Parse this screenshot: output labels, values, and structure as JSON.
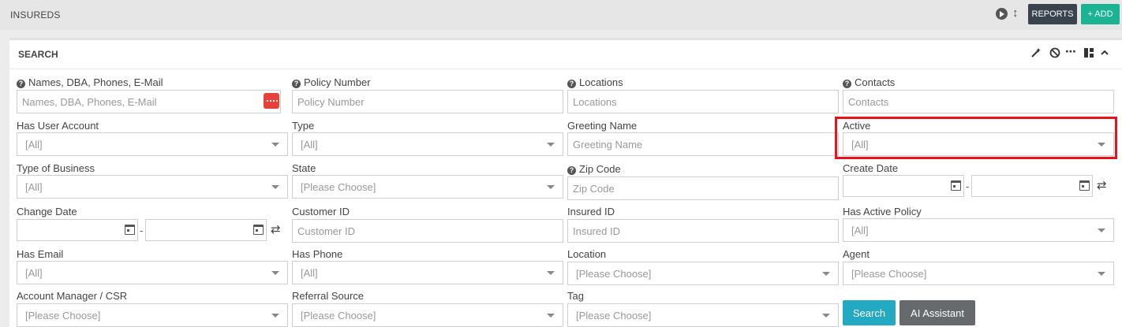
{
  "header": {
    "title": "INSUREDS",
    "icons": [
      "play-icon",
      "up-down-arrow-icon"
    ],
    "reports_label": "REPORTS",
    "add_label": "+ ADD"
  },
  "panel": {
    "title": "SEARCH",
    "toolbar_icons": [
      "magic-wand-icon",
      "ban-icon",
      "more-icon",
      "layout-icon",
      "chevron-up-icon"
    ]
  },
  "fields": {
    "names": {
      "label": "Names, DBA, Phones, E-Mail",
      "placeholder": "Names, DBA, Phones, E-Mail"
    },
    "policy_number": {
      "label": "Policy Number",
      "placeholder": "Policy Number"
    },
    "locations": {
      "label": "Locations",
      "placeholder": "Locations"
    },
    "contacts": {
      "label": "Contacts",
      "placeholder": "Contacts"
    },
    "has_user_account": {
      "label": "Has User Account",
      "value": "[All]"
    },
    "type": {
      "label": "Type",
      "value": "[All]"
    },
    "greeting_name": {
      "label": "Greeting Name",
      "placeholder": "Greeting Name"
    },
    "active": {
      "label": "Active",
      "value": "[All]"
    },
    "type_of_business": {
      "label": "Type of Business",
      "value": "[All]"
    },
    "state": {
      "label": "State",
      "value": "[Please Choose]"
    },
    "zip_code": {
      "label": "Zip Code",
      "placeholder": "Zip Code"
    },
    "create_date": {
      "label": "Create Date"
    },
    "change_date": {
      "label": "Change Date"
    },
    "customer_id": {
      "label": "Customer ID",
      "placeholder": "Customer ID"
    },
    "insured_id": {
      "label": "Insured ID",
      "placeholder": "Insured ID"
    },
    "has_active_policy": {
      "label": "Has Active Policy",
      "value": "[All]"
    },
    "has_email": {
      "label": "Has Email",
      "value": "[All]"
    },
    "has_phone": {
      "label": "Has Phone",
      "value": "[All]"
    },
    "location": {
      "label": "Location",
      "value": "[Please Choose]"
    },
    "agent": {
      "label": "Agent",
      "value": "[Please Choose]"
    },
    "account_manager": {
      "label": "Account Manager / CSR",
      "value": "[Please Choose]"
    },
    "referral_source": {
      "label": "Referral Source",
      "value": "[Please Choose]"
    },
    "tag": {
      "label": "Tag",
      "value": "[Please Choose]"
    }
  },
  "date_separator": "-",
  "actions": {
    "search_label": "Search",
    "ai_label": "AI Assistant"
  },
  "colors": {
    "add_button": "#1ab394",
    "reports_button": "#39434e",
    "search_button": "#23a9c2",
    "ai_button": "#676a6c",
    "highlight": "#e8141c"
  }
}
